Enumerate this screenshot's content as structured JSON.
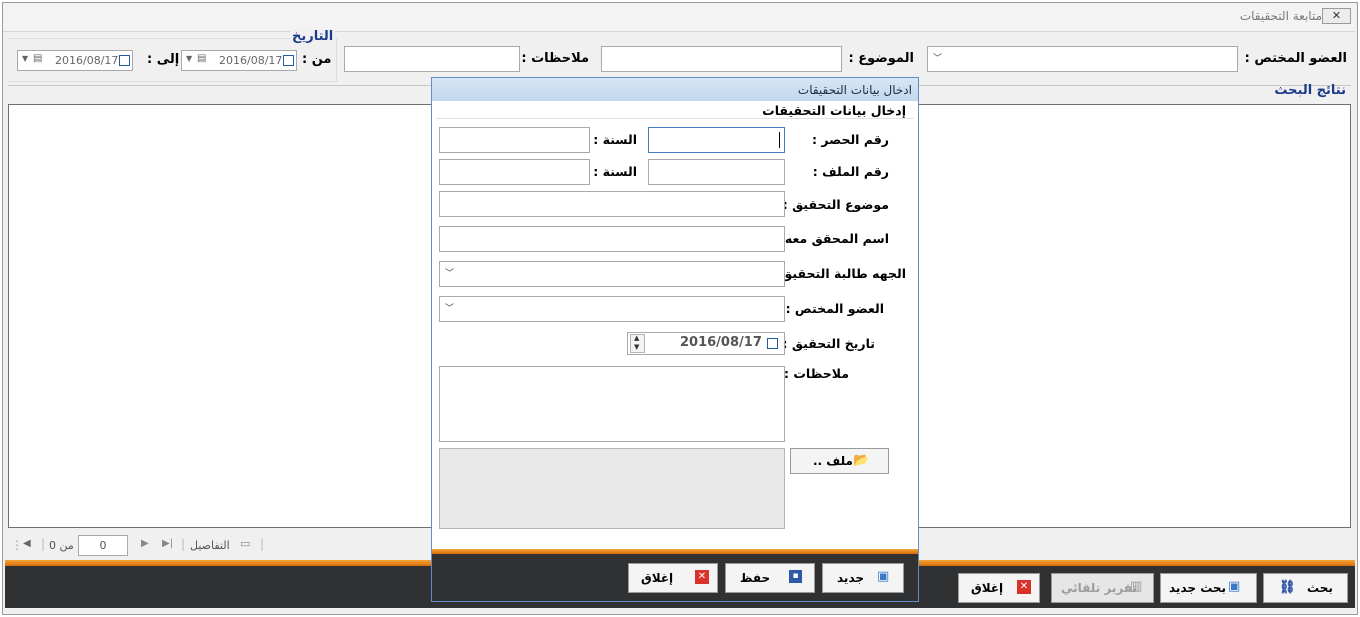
{
  "window": {
    "title": "متابعة التحقيقات",
    "close_icon": "close-icon"
  },
  "filters": {
    "member_label": "العضو المختص :",
    "member_value": "",
    "subject_label": "الموضوع :",
    "subject_value": "",
    "notes_label": "ملاحظات :",
    "notes_value": "",
    "date_group_label": "التاريخ",
    "from_label": "من :",
    "from_date": "2016/08/17",
    "to_label": "إلى :",
    "to_date": "2016/08/17"
  },
  "results": {
    "label": "نتائج البحث"
  },
  "navigator": {
    "details_label": "التفاصيل",
    "position": "0",
    "of_label": "من 0"
  },
  "toolbar": {
    "search_label": "بحث",
    "new_search_label": "بحث جديد",
    "auto_report_label": "تقرير تلقائي",
    "close_label": "إغلاق"
  },
  "dialog": {
    "title": "ادخال بيانات التحقيقات",
    "group_label": "إدخال بيانات التحقيقات",
    "inventory_label": "رقم الحصر :",
    "inventory_value": "",
    "year_label": "السنة :",
    "year_value": "",
    "file_no_label": "رقم الملف :",
    "file_no_value": "",
    "file_year_label": "السنة :",
    "file_year_value": "",
    "subject_label": "موضوع التحقيق :",
    "subject_value": "",
    "person_label": "اسم المحقق معه :",
    "person_value": "",
    "requester_label": "الجهه طالبة التحقيق :",
    "requester_value": "",
    "member_label": "العضو المختص :",
    "member_value": "",
    "date_label": "تاريخ التحقيق :",
    "date_value": "2016/08/17",
    "notes_label": "ملاحظات :",
    "notes_value": "",
    "file_button_label": "ملف ..",
    "new_label": "جديد",
    "save_label": "حفظ",
    "close_label": "إغلاق"
  },
  "colors": {
    "accent_orange": "#e88a1a",
    "dark_bar": "#2f3133",
    "dialog_border": "#5e8fc7",
    "label_blue": "#1a3a8a"
  }
}
